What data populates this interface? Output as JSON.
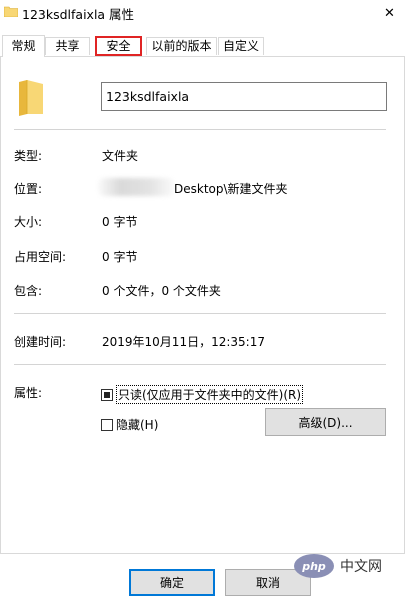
{
  "window": {
    "title": "123ksdlfaixla 属性",
    "close_glyph": "✕"
  },
  "tabs": [
    {
      "label": "常规",
      "active": true
    },
    {
      "label": "共享",
      "active": false
    },
    {
      "label": "安全",
      "active": false,
      "highlighted": true
    },
    {
      "label": "以前的版本",
      "active": false
    },
    {
      "label": "自定义",
      "active": false
    }
  ],
  "general": {
    "name_value": "123ksdlfaixla",
    "type_label": "类型:",
    "type_value": "文件夹",
    "location_label": "位置:",
    "location_value": "Desktop\\新建文件夹",
    "size_label": "大小:",
    "size_value": "0 字节",
    "disk_size_label": "占用空间:",
    "disk_size_value": "0 字节",
    "contains_label": "包含:",
    "contains_value": "0 个文件，0 个文件夹",
    "created_label": "创建时间:",
    "created_value": "2019年10月11日，12:35:17",
    "attributes_label": "属性:",
    "readonly_label": "只读(仅应用于文件夹中的文件)(R)",
    "hidden_label": "隐藏(H)",
    "advanced_button": "高级(D)..."
  },
  "footer": {
    "ok_button": "确定",
    "cancel_button": "取消"
  },
  "watermark": {
    "logo_text": "php",
    "site_text": "中文网"
  },
  "colors": {
    "highlight_border": "#e02424",
    "default_button_border": "#0078d7",
    "folder_yellow": "#f8d775"
  },
  "icons": {
    "title_icon": "folder-icon",
    "large_icon": "folder-icon",
    "close": "close-icon"
  }
}
